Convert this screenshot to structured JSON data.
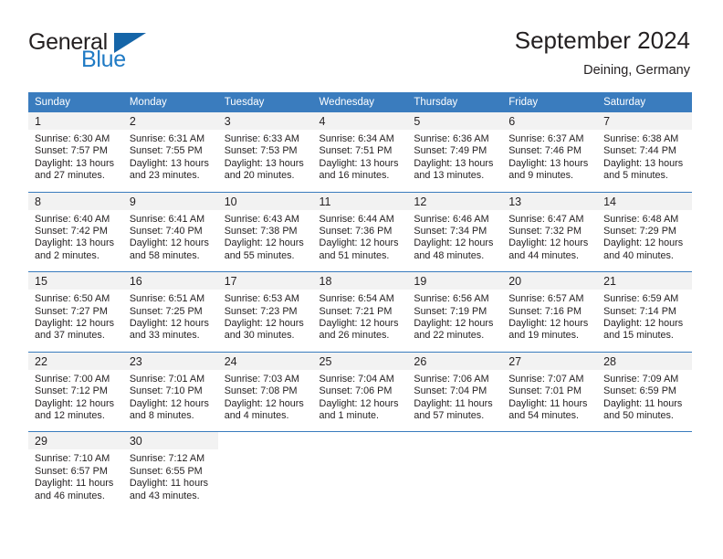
{
  "logo": {
    "primary_text": "General",
    "secondary_text": "Blue",
    "primary_color": "#231f20",
    "secondary_color": "#1f7ac4",
    "triangle_color": "#1565a8"
  },
  "header": {
    "title": "September 2024",
    "location": "Deining, Germany"
  },
  "theme": {
    "header_row_bg": "#3a7cbe",
    "header_row_text": "#ffffff",
    "daynum_bg": "#f2f2f2",
    "cell_border": "#3a7cbe",
    "text_color": "#231f20"
  },
  "weekdays": [
    "Sunday",
    "Monday",
    "Tuesday",
    "Wednesday",
    "Thursday",
    "Friday",
    "Saturday"
  ],
  "labels": {
    "sunrise_prefix": "Sunrise:",
    "sunset_prefix": "Sunset:",
    "daylight_prefix": "Daylight:"
  },
  "weeks": [
    [
      {
        "day": "1",
        "sunrise": "Sunrise: 6:30 AM",
        "sunset": "Sunset: 7:57 PM",
        "daylight_1": "Daylight: 13 hours",
        "daylight_2": "and 27 minutes."
      },
      {
        "day": "2",
        "sunrise": "Sunrise: 6:31 AM",
        "sunset": "Sunset: 7:55 PM",
        "daylight_1": "Daylight: 13 hours",
        "daylight_2": "and 23 minutes."
      },
      {
        "day": "3",
        "sunrise": "Sunrise: 6:33 AM",
        "sunset": "Sunset: 7:53 PM",
        "daylight_1": "Daylight: 13 hours",
        "daylight_2": "and 20 minutes."
      },
      {
        "day": "4",
        "sunrise": "Sunrise: 6:34 AM",
        "sunset": "Sunset: 7:51 PM",
        "daylight_1": "Daylight: 13 hours",
        "daylight_2": "and 16 minutes."
      },
      {
        "day": "5",
        "sunrise": "Sunrise: 6:36 AM",
        "sunset": "Sunset: 7:49 PM",
        "daylight_1": "Daylight: 13 hours",
        "daylight_2": "and 13 minutes."
      },
      {
        "day": "6",
        "sunrise": "Sunrise: 6:37 AM",
        "sunset": "Sunset: 7:46 PM",
        "daylight_1": "Daylight: 13 hours",
        "daylight_2": "and 9 minutes."
      },
      {
        "day": "7",
        "sunrise": "Sunrise: 6:38 AM",
        "sunset": "Sunset: 7:44 PM",
        "daylight_1": "Daylight: 13 hours",
        "daylight_2": "and 5 minutes."
      }
    ],
    [
      {
        "day": "8",
        "sunrise": "Sunrise: 6:40 AM",
        "sunset": "Sunset: 7:42 PM",
        "daylight_1": "Daylight: 13 hours",
        "daylight_2": "and 2 minutes."
      },
      {
        "day": "9",
        "sunrise": "Sunrise: 6:41 AM",
        "sunset": "Sunset: 7:40 PM",
        "daylight_1": "Daylight: 12 hours",
        "daylight_2": "and 58 minutes."
      },
      {
        "day": "10",
        "sunrise": "Sunrise: 6:43 AM",
        "sunset": "Sunset: 7:38 PM",
        "daylight_1": "Daylight: 12 hours",
        "daylight_2": "and 55 minutes."
      },
      {
        "day": "11",
        "sunrise": "Sunrise: 6:44 AM",
        "sunset": "Sunset: 7:36 PM",
        "daylight_1": "Daylight: 12 hours",
        "daylight_2": "and 51 minutes."
      },
      {
        "day": "12",
        "sunrise": "Sunrise: 6:46 AM",
        "sunset": "Sunset: 7:34 PM",
        "daylight_1": "Daylight: 12 hours",
        "daylight_2": "and 48 minutes."
      },
      {
        "day": "13",
        "sunrise": "Sunrise: 6:47 AM",
        "sunset": "Sunset: 7:32 PM",
        "daylight_1": "Daylight: 12 hours",
        "daylight_2": "and 44 minutes."
      },
      {
        "day": "14",
        "sunrise": "Sunrise: 6:48 AM",
        "sunset": "Sunset: 7:29 PM",
        "daylight_1": "Daylight: 12 hours",
        "daylight_2": "and 40 minutes."
      }
    ],
    [
      {
        "day": "15",
        "sunrise": "Sunrise: 6:50 AM",
        "sunset": "Sunset: 7:27 PM",
        "daylight_1": "Daylight: 12 hours",
        "daylight_2": "and 37 minutes."
      },
      {
        "day": "16",
        "sunrise": "Sunrise: 6:51 AM",
        "sunset": "Sunset: 7:25 PM",
        "daylight_1": "Daylight: 12 hours",
        "daylight_2": "and 33 minutes."
      },
      {
        "day": "17",
        "sunrise": "Sunrise: 6:53 AM",
        "sunset": "Sunset: 7:23 PM",
        "daylight_1": "Daylight: 12 hours",
        "daylight_2": "and 30 minutes."
      },
      {
        "day": "18",
        "sunrise": "Sunrise: 6:54 AM",
        "sunset": "Sunset: 7:21 PM",
        "daylight_1": "Daylight: 12 hours",
        "daylight_2": "and 26 minutes."
      },
      {
        "day": "19",
        "sunrise": "Sunrise: 6:56 AM",
        "sunset": "Sunset: 7:19 PM",
        "daylight_1": "Daylight: 12 hours",
        "daylight_2": "and 22 minutes."
      },
      {
        "day": "20",
        "sunrise": "Sunrise: 6:57 AM",
        "sunset": "Sunset: 7:16 PM",
        "daylight_1": "Daylight: 12 hours",
        "daylight_2": "and 19 minutes."
      },
      {
        "day": "21",
        "sunrise": "Sunrise: 6:59 AM",
        "sunset": "Sunset: 7:14 PM",
        "daylight_1": "Daylight: 12 hours",
        "daylight_2": "and 15 minutes."
      }
    ],
    [
      {
        "day": "22",
        "sunrise": "Sunrise: 7:00 AM",
        "sunset": "Sunset: 7:12 PM",
        "daylight_1": "Daylight: 12 hours",
        "daylight_2": "and 12 minutes."
      },
      {
        "day": "23",
        "sunrise": "Sunrise: 7:01 AM",
        "sunset": "Sunset: 7:10 PM",
        "daylight_1": "Daylight: 12 hours",
        "daylight_2": "and 8 minutes."
      },
      {
        "day": "24",
        "sunrise": "Sunrise: 7:03 AM",
        "sunset": "Sunset: 7:08 PM",
        "daylight_1": "Daylight: 12 hours",
        "daylight_2": "and 4 minutes."
      },
      {
        "day": "25",
        "sunrise": "Sunrise: 7:04 AM",
        "sunset": "Sunset: 7:06 PM",
        "daylight_1": "Daylight: 12 hours",
        "daylight_2": "and 1 minute."
      },
      {
        "day": "26",
        "sunrise": "Sunrise: 7:06 AM",
        "sunset": "Sunset: 7:04 PM",
        "daylight_1": "Daylight: 11 hours",
        "daylight_2": "and 57 minutes."
      },
      {
        "day": "27",
        "sunrise": "Sunrise: 7:07 AM",
        "sunset": "Sunset: 7:01 PM",
        "daylight_1": "Daylight: 11 hours",
        "daylight_2": "and 54 minutes."
      },
      {
        "day": "28",
        "sunrise": "Sunrise: 7:09 AM",
        "sunset": "Sunset: 6:59 PM",
        "daylight_1": "Daylight: 11 hours",
        "daylight_2": "and 50 minutes."
      }
    ],
    [
      {
        "day": "29",
        "sunrise": "Sunrise: 7:10 AM",
        "sunset": "Sunset: 6:57 PM",
        "daylight_1": "Daylight: 11 hours",
        "daylight_2": "and 46 minutes."
      },
      {
        "day": "30",
        "sunrise": "Sunrise: 7:12 AM",
        "sunset": "Sunset: 6:55 PM",
        "daylight_1": "Daylight: 11 hours",
        "daylight_2": "and 43 minutes."
      },
      {
        "day": "",
        "sunrise": "",
        "sunset": "",
        "daylight_1": "",
        "daylight_2": ""
      },
      {
        "day": "",
        "sunrise": "",
        "sunset": "",
        "daylight_1": "",
        "daylight_2": ""
      },
      {
        "day": "",
        "sunrise": "",
        "sunset": "",
        "daylight_1": "",
        "daylight_2": ""
      },
      {
        "day": "",
        "sunrise": "",
        "sunset": "",
        "daylight_1": "",
        "daylight_2": ""
      },
      {
        "day": "",
        "sunrise": "",
        "sunset": "",
        "daylight_1": "",
        "daylight_2": ""
      }
    ]
  ]
}
